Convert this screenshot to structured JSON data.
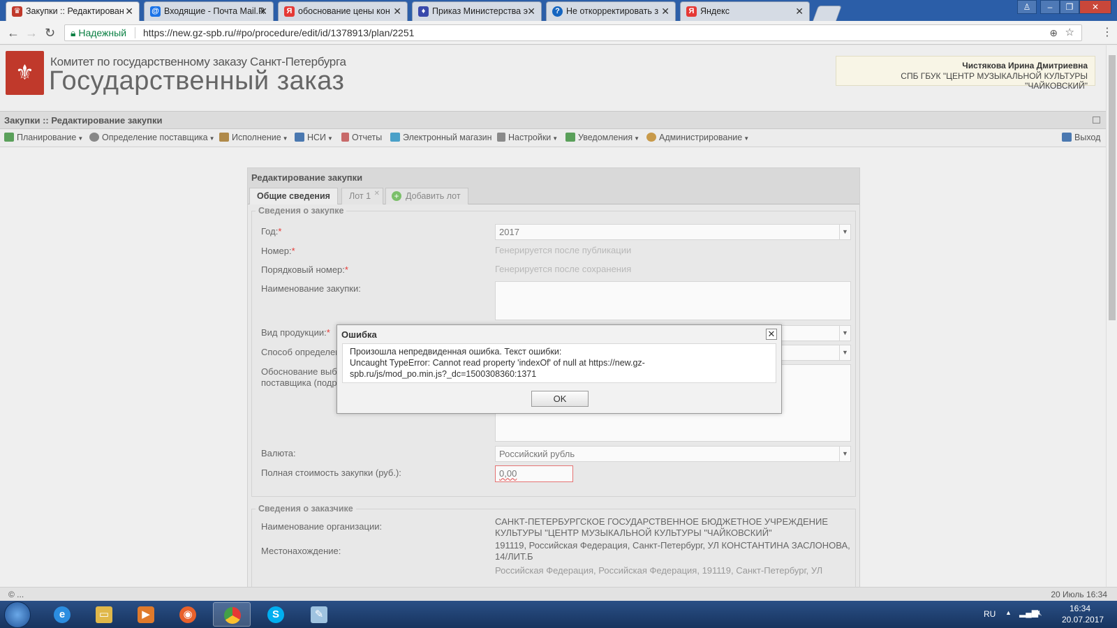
{
  "browser": {
    "tabs": [
      {
        "title": "Закупки :: Редактирован",
        "color": "#c0392b",
        "glyph": "♛"
      },
      {
        "title": "Входящие - Почта Mail.R",
        "color": "#1a73e8",
        "glyph": "@"
      },
      {
        "title": "обоснование цены кон",
        "color": "#e53935",
        "glyph": "Я"
      },
      {
        "title": "Приказ Министерства э",
        "color": "#3949ab",
        "glyph": "♦"
      },
      {
        "title": "Не откорректировать з",
        "color": "#1565c0",
        "glyph": "?"
      },
      {
        "title": "Яндекс",
        "color": "#e53935",
        "glyph": "Я"
      }
    ],
    "secure_label": "Надежный",
    "url": "https://new.gz-spb.ru/#po/procedure/edit/id/1378913/plan/2251"
  },
  "header": {
    "org_title": "Комитет по государственному заказу Санкт-Петербурга",
    "site_title": "Государственный заказ",
    "user_name": "Чистякова Ирина Дмитриевна",
    "user_org": "СПБ ГБУК \"ЦЕНТР МУЗЫКАЛЬНОЙ КУЛЬТУРЫ \"ЧАЙКОВСКИЙ\""
  },
  "pagebar": {
    "title": "Закупки :: Редактирование закупки"
  },
  "menu": [
    {
      "label": "Планирование",
      "caret": true,
      "color": "#5aa05a"
    },
    {
      "label": "Определение поставщика",
      "caret": true,
      "color": "#888"
    },
    {
      "label": "Исполнение",
      "caret": true,
      "color": "#b08a4a"
    },
    {
      "label": "НСИ",
      "caret": true,
      "color": "#4a78b0"
    },
    {
      "label": "Отчеты",
      "caret": false,
      "color": "#c86a6a"
    },
    {
      "label": "Электронный магазин",
      "caret": false,
      "color": "#4aa0c8"
    },
    {
      "label": "Настройки",
      "caret": true,
      "color": "#8a8a8a"
    },
    {
      "label": "Уведомления",
      "caret": true,
      "color": "#5aa05a"
    },
    {
      "label": "Администрирование",
      "caret": true,
      "color": "#c89a4a"
    }
  ],
  "logout_label": "Выход",
  "form": {
    "panel_title": "Редактирование закупки",
    "tabs": {
      "general": "Общие сведения",
      "lot1": "Лот 1",
      "add_lot": "Добавить лот"
    },
    "section1_title": "Сведения о закупке",
    "year_label": "Год:",
    "year_value": "2017",
    "number_label": "Номер:",
    "number_hint": "Генерируется после публикации",
    "seq_label": "Порядковый номер:",
    "seq_hint": "Генерируется после сохранения",
    "name_label": "Наименование закупки:",
    "product_label": "Вид продукции:",
    "method_label": "Способ определения поставщика:",
    "justification_label_1": "Обоснование выбранного способа определения",
    "justification_label_2": "поставщика (подрядчика, исполнителя):",
    "currency_label": "Валюта:",
    "currency_value": "Российский рубль",
    "total_label": "Полная стоимость закупки (руб.):",
    "total_value": "0,00",
    "section2_title": "Сведения о заказчике",
    "org_name_label": "Наименование организации:",
    "org_name_1": "САНКТ-ПЕТЕРБУРГСКОЕ ГОСУДАРСТВЕННОЕ БЮДЖЕТНОЕ УЧРЕЖДЕНИЕ",
    "org_name_2": "КУЛЬТУРЫ \"ЦЕНТР МУЗЫКАЛЬНОЙ КУЛЬТУРЫ \"ЧАЙКОВСКИЙ\"",
    "location_label": "Местонахождение:",
    "location_1": "191119, Российская Федерация, Санкт-Петербург, УЛ КОНСТАНТИНА ЗАСЛОНОВА,",
    "location_2": "14/ЛИТ.Б",
    "cut_line": "Российская Федерация, Российская Федерация, 191119, Санкт-Петербург, УЛ"
  },
  "dialog": {
    "title": "Ошибка",
    "line1": "Произошла непредвиденная ошибка. Текст ошибки:",
    "line2": "Uncaught TypeError: Cannot read property 'indexOf' of null at https://new.gz-",
    "line3": "spb.ru/js/mod_po.min.js?_dc=1500308360:1371",
    "ok_label": "OK"
  },
  "status": {
    "left": "© ...",
    "right": "20 Июль 16:34"
  },
  "taskbar": {
    "lang": "RU",
    "time": "16:34",
    "date": "20.07.2017"
  }
}
